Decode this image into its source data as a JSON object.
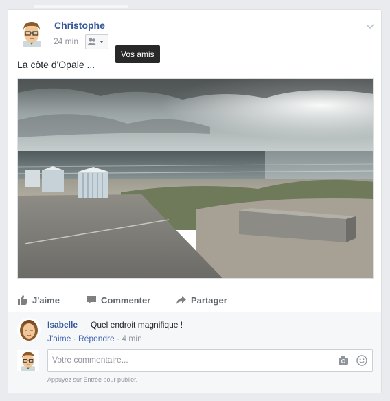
{
  "post": {
    "author": "Christophe",
    "timestamp": "24 min",
    "audience_icon": "friends-icon",
    "audience_tooltip": "Vos amis",
    "text": "La côte d'Opale ...",
    "photo_icon": "beach-photo"
  },
  "actions": {
    "like": "J'aime",
    "comment": "Commenter",
    "share": "Partager"
  },
  "comment": {
    "author": "Isabelle",
    "text": "Quel endroit magnifique !",
    "like": "J'aime",
    "sep1": "·",
    "reply": "Répondre",
    "sep2": "·",
    "time": "4 min"
  },
  "composer": {
    "placeholder": "Votre commentaire...",
    "hint": "Appuyez sur Entrée pour publier."
  },
  "colors": {
    "link": "#365899",
    "muted": "#90949c",
    "action": "#606770",
    "background": "#e9ebee"
  }
}
